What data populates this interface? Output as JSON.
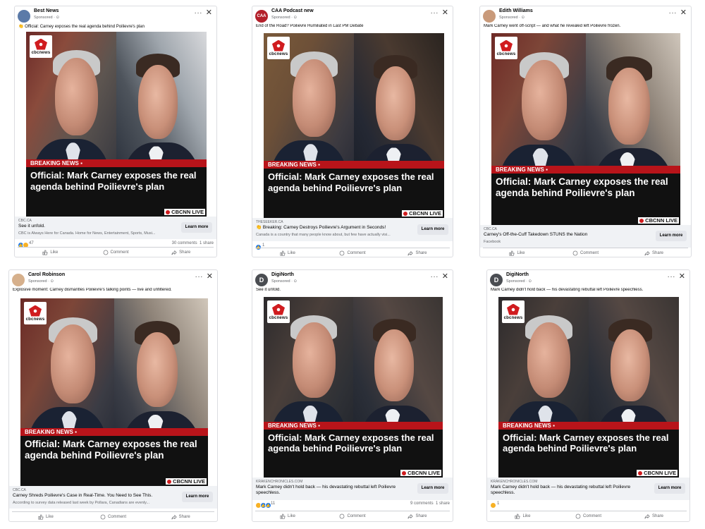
{
  "actions": {
    "like": "Like",
    "comment": "Comment",
    "share": "Share"
  },
  "cbc_logo_text": "cbcnews",
  "live_tag": "CBCNN LIVE",
  "breaking": "BREAKING NEWS ▪",
  "headline": "Official: Mark Carney exposes the real agenda behind Poilievre's plan",
  "ads": [
    {
      "page_name": "Best News",
      "sponsored": "Sponsored · ⊙",
      "caption": "👏 Official: Carney exposes the real agenda behind Poilievre's plan",
      "domain": "CBC.CA",
      "link_title": "See it unfold.",
      "link_desc": "CBC is Always Here for Canada. Home for News, Entertainment, Sports, Musi...",
      "learn_more": "Learn more",
      "reaction_count": "47",
      "comments": "30 comments",
      "shares": "1 share"
    },
    {
      "page_name": "CAA Podcast new",
      "sponsored": "Sponsored · ⊙",
      "caption": "End of the Road? Poilievre Humiliated in Last PM Debate",
      "domain": "THESEEKER.CA",
      "link_title": "👏 Breaking: Carney Destroys Poilievre's Argument in Seconds!",
      "link_desc": "Canada is a country that many people know about, but few have actually visi...",
      "learn_more": "Learn more",
      "reaction_count": "1",
      "comments": "",
      "shares": ""
    },
    {
      "page_name": "Edith Williams",
      "sponsored": "Sponsored · ⊙",
      "caption": "Mark Carney went off-script — and what he revealed left Poilievre frozen.",
      "domain": "CBC.CA",
      "link_title": "Carney's Off-the-Cuff Takedown STUNS the Nation",
      "link_desc": "Facebook",
      "learn_more": "Learn more",
      "reaction_count": "",
      "comments": "",
      "shares": ""
    },
    {
      "page_name": "Carol Robinson",
      "sponsored": "Sponsored · ⊙",
      "caption": "Explosive moment: Carney dismantles Poilievre's talking points — live and unfiltered.",
      "domain": "CBC.CA",
      "link_title": "Carney Shreds Poilievre's Case in Real-Time. You Need to See This.",
      "link_desc": "According to survey data released last week by Pollara, Canadians are evenly...",
      "learn_more": "Learn more",
      "reaction_count": "",
      "comments": "",
      "shares": ""
    },
    {
      "page_name": "DigiNorth",
      "sponsored": "Sponsored · ⊙",
      "caption": "See it unfold.",
      "domain": "KRAKENCHRONICLES.COM",
      "link_title": "Mark Carney didn't hold back — his devastating rebuttal left Poilievre speechless.",
      "link_desc": "",
      "learn_more": "Learn more",
      "reaction_count": "11",
      "comments": "9 comments",
      "shares": "1 share"
    },
    {
      "page_name": "DigiNorth",
      "sponsored": "Sponsored · ⊙",
      "caption": "Mark Carney didn't hold back — his devastating rebuttal left Poilievre speechless.",
      "domain": "KRAKENCHRONICLES.COM",
      "link_title": "Mark Carney didn't hold back — his devastating rebuttal left Poilievre speechless.",
      "link_desc": "",
      "learn_more": "Learn more",
      "reaction_count": "1",
      "comments": "",
      "shares": ""
    }
  ],
  "avatar_letters": {
    "diginorth": "D",
    "caa": "CAA"
  }
}
